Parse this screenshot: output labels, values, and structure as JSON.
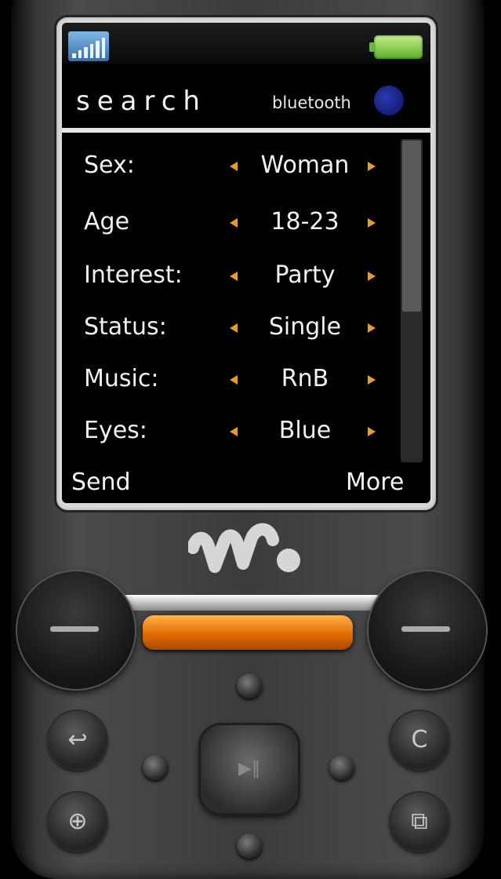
{
  "header": {
    "title": "search",
    "bluetooth_label": "bluetooth"
  },
  "status": {
    "signal_icon": "signal-strength-icon",
    "battery_icon": "battery-icon"
  },
  "filters": [
    {
      "label": "Sex:",
      "value": "Woman"
    },
    {
      "label": "Age",
      "value": "18-23"
    },
    {
      "label": "Interest:",
      "value": "Party"
    },
    {
      "label": "Status:",
      "value": "Single"
    },
    {
      "label": "Music:",
      "value": "RnB"
    },
    {
      "label": "Eyes:",
      "value": "Blue"
    }
  ],
  "softkeys": {
    "left": "Send",
    "right": "More"
  },
  "keypad": {
    "clear_key": "C"
  },
  "colors": {
    "arrow": "#e89a2a",
    "accent_key": "#e26a00",
    "bluetooth": "#1a2590",
    "battery": "#5cae2a"
  }
}
